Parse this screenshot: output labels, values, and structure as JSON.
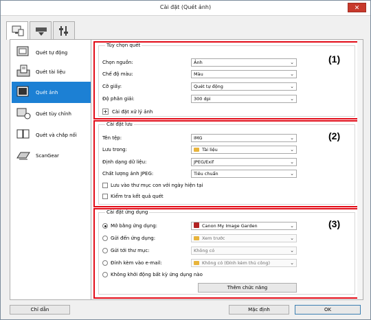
{
  "window": {
    "title": "Cài đặt (Quét ảnh)",
    "close_glyph": "✕"
  },
  "tabs": [
    {
      "icon": "scan-from-computer-icon"
    },
    {
      "icon": "scan-from-panel-icon"
    },
    {
      "icon": "general-settings-icon"
    }
  ],
  "sidebar": {
    "items": [
      {
        "label": "Quét tự động",
        "icon": "auto-scan-icon"
      },
      {
        "label": "Quét tài liệu",
        "icon": "document-scan-icon"
      },
      {
        "label": "Quét ảnh",
        "icon": "photo-scan-icon",
        "selected": true
      },
      {
        "label": "Quét tùy chỉnh",
        "icon": "custom-scan-icon"
      },
      {
        "label": "Quét và chắp nối",
        "icon": "scan-stitch-icon"
      },
      {
        "label": "ScanGear",
        "icon": "scangear-icon"
      }
    ]
  },
  "scan_options": {
    "title": "Tùy chọn quét",
    "badge": "(1)",
    "source_label": "Chọn nguồn:",
    "source_value": "Ảnh",
    "color_label": "Chế độ màu:",
    "color_value": "Màu",
    "paper_label": "Cỡ giấy:",
    "paper_value": "Quét tự động",
    "resolution_label": "Độ phân giải:",
    "resolution_value": "300 dpi",
    "image_processing_label": "Cài đặt xử lý ảnh"
  },
  "save_settings": {
    "title": "Cài đặt lưu",
    "badge": "(2)",
    "filename_label": "Tên tệp:",
    "filename_value": "IMG",
    "save_in_label": "Lưu trong:",
    "save_in_value": "Tài liệu",
    "format_label": "Định dạng dữ liệu:",
    "format_value": "JPEG/Exif",
    "jpeg_label": "Chất lượng ảnh JPEG:",
    "jpeg_value": "Tiêu chuẩn",
    "subfolder_label": "Lưu vào thư mục con với ngày hiện tại",
    "check_result_label": "Kiểm tra kết quả quét"
  },
  "app_settings": {
    "title": "Cài đặt ứng dụng",
    "badge": "(3)",
    "open_with_label": "Mở bằng ứng dụng:",
    "open_with_value": "Canon My Image Garden",
    "send_app_label": "Gửi đến ứng dụng:",
    "send_app_value": "Xem trước",
    "send_folder_label": "Gửi tới thư mục:",
    "send_folder_value": "Không có",
    "email_label": "Đính kèm vào e-mail:",
    "email_value": "Không có (Đính kèm thủ công)",
    "none_label": "Không khởi động bất kỳ ứng dụng nào",
    "add_function_label": "Thêm chức năng"
  },
  "footer": {
    "help": "Chỉ dẫn",
    "defaults": "Mặc định",
    "ok": "OK"
  },
  "colors": {
    "highlight": "#e20a16",
    "selection": "#1c80d4"
  }
}
